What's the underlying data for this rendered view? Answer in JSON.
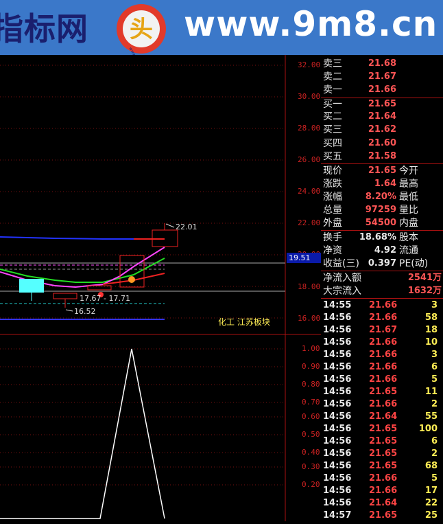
{
  "banner": {
    "brand_text": "指标网",
    "logo_char": "头",
    "logo_small": "www.9m8.cn",
    "site_text": "www.9m8.cn"
  },
  "chart": {
    "price_axis": [
      "32.00",
      "30.00",
      "28.00",
      "26.00",
      "24.00",
      "22.00",
      "20.00",
      "18.00",
      "16.00"
    ],
    "current_price_tag": "19.51",
    "annotations": {
      "high": "22.01",
      "low": "16.52",
      "mid": "17.67 - 17.71"
    },
    "sector_tag": "化工 江苏板块",
    "indicator_axis": [
      "1.00",
      "0.90",
      "0.80",
      "0.70",
      "0.60",
      "0.50",
      "0.40",
      "0.30",
      "0.20"
    ]
  },
  "quote": {
    "sell": [
      {
        "label": "卖三",
        "price": "21.68"
      },
      {
        "label": "卖二",
        "price": "21.67"
      },
      {
        "label": "卖一",
        "price": "21.66"
      }
    ],
    "buy": [
      {
        "label": "买一",
        "price": "21.65"
      },
      {
        "label": "买二",
        "price": "21.64"
      },
      {
        "label": "买三",
        "price": "21.62"
      },
      {
        "label": "买四",
        "price": "21.60"
      },
      {
        "label": "买五",
        "price": "21.58"
      }
    ],
    "stats1": [
      {
        "label": "现价",
        "value": "21.65",
        "label2": "今开"
      },
      {
        "label": "涨跌",
        "value": "1.64",
        "label2": "最高"
      },
      {
        "label": "涨幅",
        "value": "8.20%",
        "label2": "最低"
      },
      {
        "label": "总量",
        "value": "97259",
        "label2": "量比"
      },
      {
        "label": "外盘",
        "value": "54500",
        "label2": "内盘"
      }
    ],
    "stats2": [
      {
        "label": "换手",
        "value": "18.68%",
        "label2": "股本"
      },
      {
        "label": "净资",
        "value": "4.92",
        "label2": "流通"
      },
      {
        "label": "收益(三)",
        "value": "0.397",
        "label2": "PE(动)"
      }
    ],
    "flow": [
      {
        "label": "净流入额",
        "value": "2541万"
      },
      {
        "label": "大宗流入",
        "value": "1632万"
      }
    ]
  },
  "ticks": [
    {
      "time": "14:55",
      "price": "21.66",
      "vol": "3"
    },
    {
      "time": "14:56",
      "price": "21.66",
      "vol": "58"
    },
    {
      "time": "14:56",
      "price": "21.67",
      "vol": "18"
    },
    {
      "time": "14:56",
      "price": "21.66",
      "vol": "10"
    },
    {
      "time": "14:56",
      "price": "21.66",
      "vol": "3"
    },
    {
      "time": "14:56",
      "price": "21.66",
      "vol": "6"
    },
    {
      "time": "14:56",
      "price": "21.66",
      "vol": "5"
    },
    {
      "time": "14:56",
      "price": "21.65",
      "vol": "11"
    },
    {
      "time": "14:56",
      "price": "21.66",
      "vol": "2"
    },
    {
      "time": "14:56",
      "price": "21.64",
      "vol": "55"
    },
    {
      "time": "14:56",
      "price": "21.65",
      "vol": "100"
    },
    {
      "time": "14:56",
      "price": "21.65",
      "vol": "6"
    },
    {
      "time": "14:56",
      "price": "21.65",
      "vol": "2"
    },
    {
      "time": "14:56",
      "price": "21.65",
      "vol": "68"
    },
    {
      "time": "14:56",
      "price": "21.66",
      "vol": "5"
    },
    {
      "time": "14:56",
      "price": "21.66",
      "vol": "17"
    },
    {
      "time": "14:56",
      "price": "21.64",
      "vol": "22"
    },
    {
      "time": "14:57",
      "price": "21.65",
      "vol": "25"
    }
  ],
  "colors": {
    "banner": "#3b78c9",
    "up": "#ff4444",
    "grid": "#aa1111",
    "volume": "#ffee55"
  }
}
